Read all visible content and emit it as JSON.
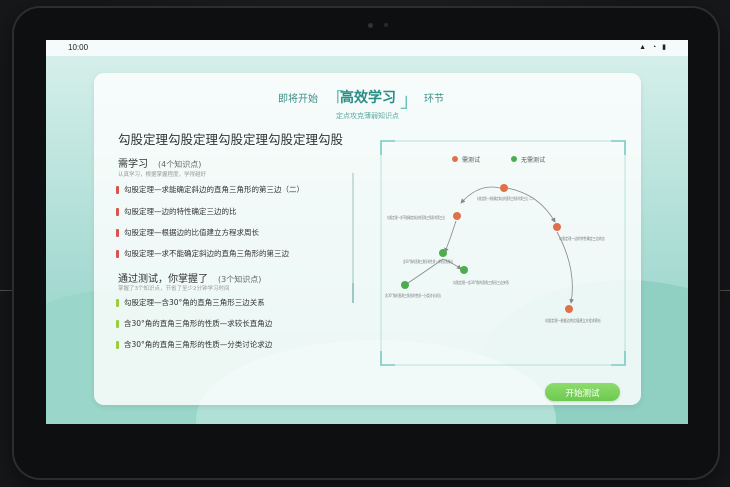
{
  "status_bar": {
    "time": "10:00",
    "icons": "▲ ◔ ▮"
  },
  "header": {
    "prefix": "即将开始",
    "bracket_left": "「",
    "highlight": "高效学习",
    "bracket_right": "」",
    "suffix": "环节",
    "subtitle": "定点攻克薄弱知识点"
  },
  "topic_title": "勾股定理勾股定理勾股定理勾股定理勾股",
  "need_learn": {
    "heading": "需学习",
    "count": "(4个知识点)",
    "note": "认真学习，根据掌握程度，学得越好",
    "items": [
      "勾股定理—求能确定斜边的直角三角形的第三边（二）",
      "勾股定理—边的特性确定三边的比",
      "勾股定理—根据边的比值建立方程求周长",
      "勾股定理—求不能确定斜边的直角三角形的第三边"
    ]
  },
  "mastered": {
    "heading": "通过测试，你掌握了",
    "count": "(3个知识点)",
    "note": "掌握了3个知识点，节省了至少2分钟学习时间",
    "items": [
      "勾股定理—含30°角的直角三角形三边关系",
      "含30°角的直角三角形的性质—求较长直角边",
      "含30°角的直角三角形的性质—分类讨论求边"
    ]
  },
  "graph": {
    "legend": [
      {
        "label": "需测试",
        "color": "#e0704a"
      },
      {
        "label": "无需测试",
        "color": "#4cad4f"
      }
    ],
    "node_labels": [
      "勾股定理—求能确定斜边的直角三角形的第三边（二）",
      "勾股定理—求不能确定斜边的直角三角形的第三边",
      "勾股定理—边的特性确定三边的比",
      "含30°角的直角三角形的性质—求较长直角边",
      "勾股定理—含30°角的直角三角形三边关系",
      "含30°角的直角三角形的性质—分类讨论求边",
      "勾股定理—根据边的比值建立方程求周长"
    ]
  },
  "start_button": "开始测试",
  "colors": {
    "need": "#e0704a",
    "mastered": "#9ccd3d",
    "accent": "#2a8c84"
  }
}
